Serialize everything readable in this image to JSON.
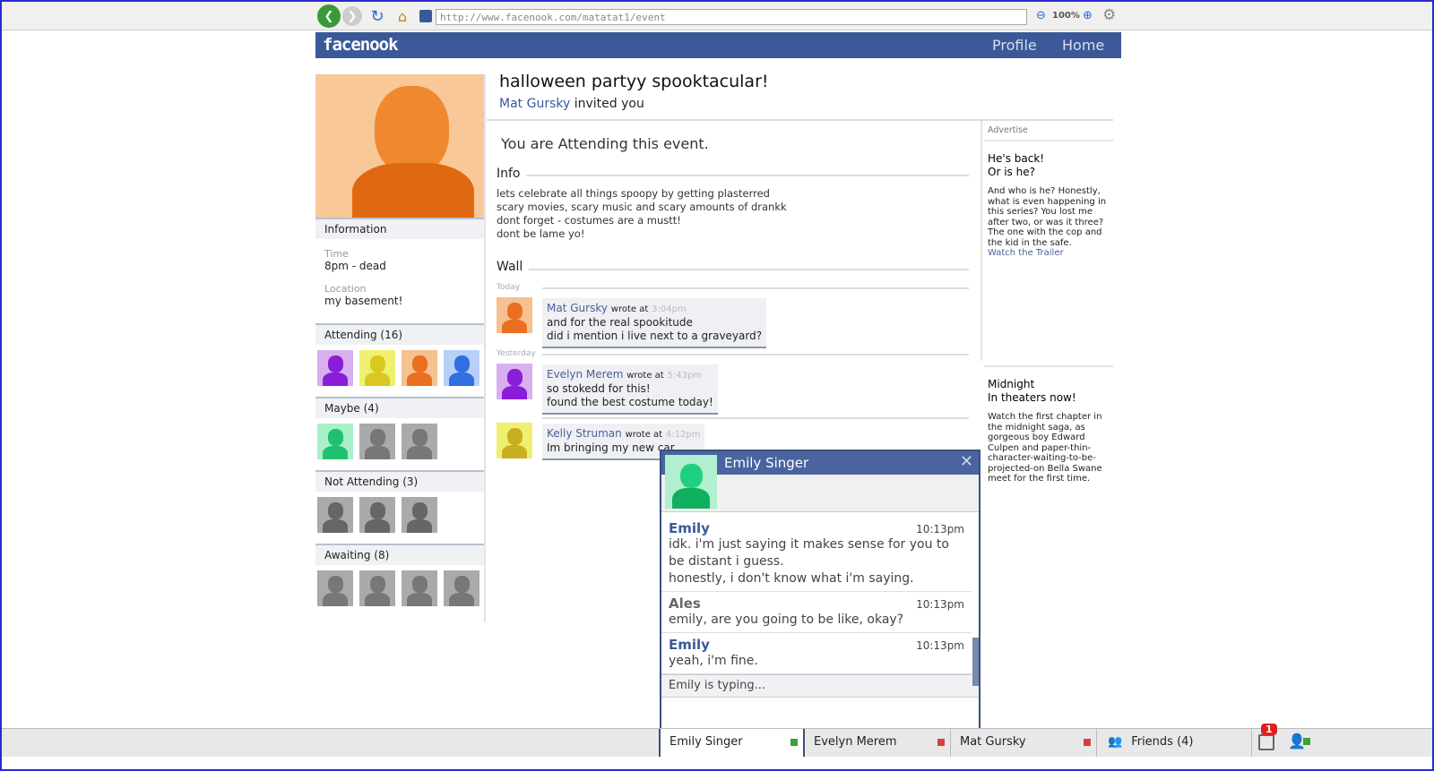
{
  "browser": {
    "url": "http://www.facenook.com/matatat1/event",
    "zoom": "100%"
  },
  "nav": {
    "logo": "facenook",
    "links": [
      "Profile",
      "Home"
    ]
  },
  "event": {
    "title": "halloween partyy spooktacular!",
    "inviter": "Mat Gursky",
    "invited_text": "invited you",
    "status": "You are Attending this event."
  },
  "sidebar": {
    "info_header": "Information",
    "time_label": "Time",
    "time": "8pm - dead",
    "location_label": "Location",
    "location": "my basement!",
    "groups": [
      {
        "label": "Attending (16)",
        "avatars": [
          [
            "#d8b0f0",
            "#8a1ed8"
          ],
          [
            "#f0f070",
            "#d8c820"
          ],
          [
            "#f6c090",
            "#e87020"
          ],
          [
            "#b8d0f8",
            "#3070e0"
          ]
        ]
      },
      {
        "label": "Maybe (4)",
        "avatars": [
          [
            "#a8f0c8",
            "#20c070"
          ],
          [
            "#aaaaaa",
            "#777777"
          ],
          [
            "#aaaaaa",
            "#777777"
          ]
        ]
      },
      {
        "label": "Not Attending (3)",
        "avatars": [
          [
            "#aaaaaa",
            "#666666"
          ],
          [
            "#aaaaaa",
            "#666666"
          ],
          [
            "#aaaaaa",
            "#666666"
          ]
        ]
      },
      {
        "label": "Awaiting (8)",
        "avatars": [
          [
            "#aaaaaa",
            "#777777"
          ],
          [
            "#aaaaaa",
            "#777777"
          ],
          [
            "#aaaaaa",
            "#777777"
          ],
          [
            "#aaaaaa",
            "#777777"
          ]
        ]
      }
    ]
  },
  "info": {
    "header": "Info",
    "lines": [
      "lets celebrate all things spoopy by getting plasterred",
      "scary movies, scary music and scary amounts of drankk",
      "dont forget - costumes are a mustt!",
      "dont be lame yo!"
    ]
  },
  "wall": {
    "header": "Wall",
    "today": "Today",
    "yesterday": "Yesterday",
    "wrote_at": "wrote at",
    "posts": [
      {
        "name": "Mat Gursky",
        "time": "3:04pm",
        "lines": [
          "and for the real spookitude",
          "did i mention i live next to a graveyard?"
        ],
        "colors": [
          "#f6c090",
          "#e87020"
        ]
      },
      {
        "name": "Evelyn Merem",
        "time": "5:43pm",
        "lines": [
          "so stokedd for this!",
          "found the best costume today!"
        ],
        "colors": [
          "#d8b0f0",
          "#8a1ed8"
        ]
      },
      {
        "name": "Kelly Struman",
        "time": "4:12pm",
        "lines": [
          "Im bringing my new car"
        ],
        "colors": [
          "#f0f070",
          "#c8b020"
        ]
      }
    ]
  },
  "ads": {
    "header": "Advertise",
    "items": [
      {
        "title": [
          "He's back!",
          "Or is he?"
        ],
        "body": "And who is he? Honestly, what is even happening in this series? You lost me after two, or was it three? The one with the cop and the kid in the safe.",
        "link": "Watch the Trailer"
      },
      {
        "title": [
          "Midnight",
          "In theaters now!"
        ],
        "body": "Watch the first chapter in the midnight saga, as gorgeous boy Edward Culpen and paper-thin-character-waiting-to-be-projected-on Bella Swane meet for the first time.",
        "link": ""
      }
    ]
  },
  "chat": {
    "name": "Emily Singer",
    "messages": [
      {
        "from": "Emily",
        "time": "10:13pm",
        "text": [
          "idk. i'm just saying it makes sense for you to be distant i guess.",
          "honestly, i don't know what i'm saying."
        ]
      },
      {
        "from": "Ales",
        "time": "10:13pm",
        "text": [
          "emily, are you going to be like, okay?"
        ]
      },
      {
        "from": "Emily",
        "time": "10:13pm",
        "text": [
          "yeah, i'm fine."
        ]
      }
    ],
    "typing": "Emily is typing..."
  },
  "bottom": {
    "tabs": [
      {
        "name": "Emily Singer",
        "status": "#3aa03a"
      },
      {
        "name": "Evelyn Merem",
        "status": "#d84040"
      },
      {
        "name": "Mat Gursky",
        "status": "#d84040"
      }
    ],
    "friends": "Friends (4)",
    "notifications": "1"
  }
}
